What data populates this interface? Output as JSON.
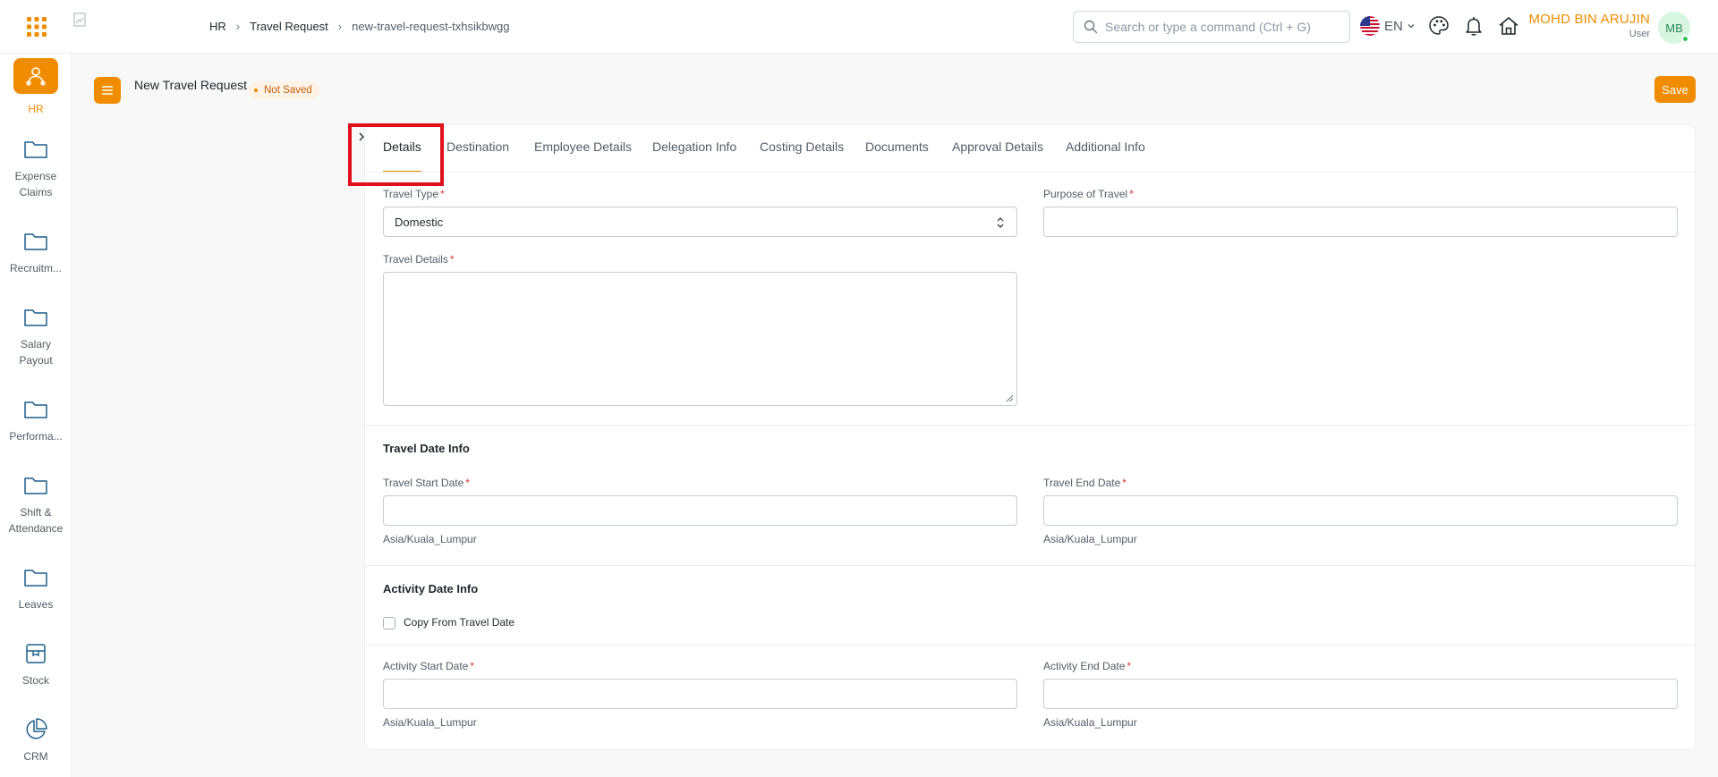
{
  "navbar": {
    "breadcrumbs": [
      "HR",
      "Travel Request",
      "new-travel-request-txhsikbwgg"
    ],
    "search_placeholder": "Search or type a command (Ctrl + G)",
    "language": "EN",
    "user_name": "MOHD BIN ARUJIN",
    "user_role": "User",
    "avatar_initials": "MB",
    "icons": [
      "apps-grid-icon",
      "palette-icon",
      "bell-icon",
      "home-icon"
    ]
  },
  "sidebar": {
    "items": [
      {
        "label": "HR",
        "icon": "hr-people-icon",
        "active": true
      },
      {
        "label": "Expense Claims",
        "icon": "folder-icon"
      },
      {
        "label": "Recruitm...",
        "icon": "folder-icon"
      },
      {
        "label": "Salary Payout",
        "icon": "folder-icon"
      },
      {
        "label": "Performa...",
        "icon": "folder-icon"
      },
      {
        "label": "Shift & Attendance",
        "icon": "folder-icon"
      },
      {
        "label": "Leaves",
        "icon": "folder-icon"
      },
      {
        "label": "Stock",
        "icon": "box-icon"
      },
      {
        "label": "CRM",
        "icon": "pie-chart-icon"
      }
    ]
  },
  "page": {
    "title": "New Travel Request",
    "status": "Not Saved",
    "save_label": "Save"
  },
  "tabs": [
    "Details",
    "Destination",
    "Employee Details",
    "Delegation Info",
    "Costing Details",
    "Documents",
    "Approval Details",
    "Additional Info"
  ],
  "active_tab": "Details",
  "form": {
    "travel_type": {
      "label": "Travel Type",
      "value": "Domestic",
      "required": "*"
    },
    "purpose_of_travel": {
      "label": "Purpose of Travel",
      "value": "",
      "required": "*"
    },
    "travel_details": {
      "label": "Travel Details",
      "value": "",
      "required": "*"
    },
    "travel_date_info": {
      "title": "Travel Date Info",
      "start_label": "Travel Start Date",
      "end_label": "Travel End Date",
      "timezone": "Asia/Kuala_Lumpur"
    },
    "activity_date_info": {
      "title": "Activity Date Info",
      "copy_label": "Copy From Travel Date",
      "copy_checked": false,
      "start_label": "Activity Start Date",
      "end_label": "Activity End Date",
      "timezone": "Asia/Kuala_Lumpur"
    }
  },
  "colors": {
    "accent": "#f08c00",
    "highlight": "#e0111b",
    "required": "#e03636"
  }
}
